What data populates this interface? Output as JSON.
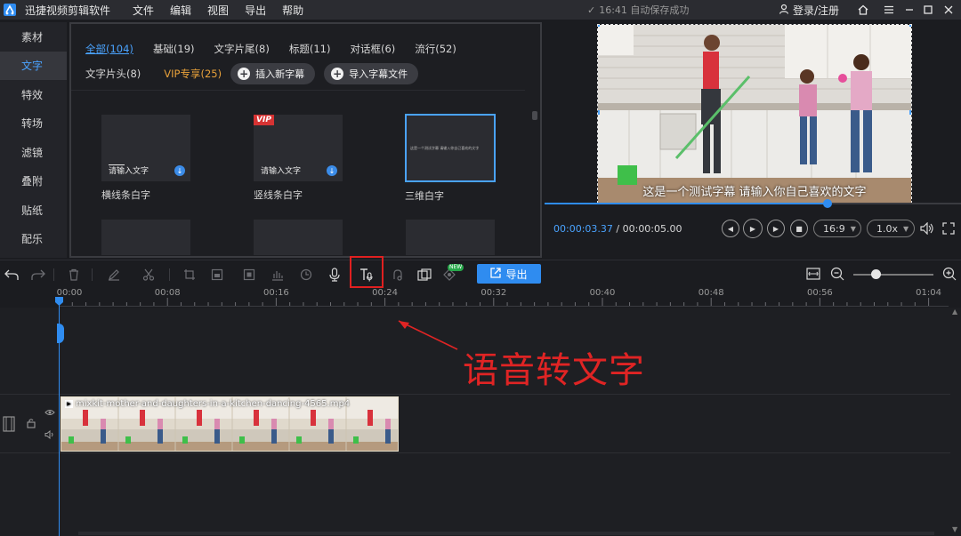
{
  "app": {
    "name": "迅捷视频剪辑软件",
    "menu": [
      "文件",
      "编辑",
      "视图",
      "导出",
      "帮助"
    ],
    "autosave": "16:41 自动保存成功",
    "login": "登录/注册",
    "icons": [
      "app-logo-icon",
      "home-icon",
      "settings-icon",
      "minimize-icon",
      "maximize-icon",
      "close-icon"
    ]
  },
  "left_nav": {
    "items": [
      "素材",
      "文字",
      "特效",
      "转场",
      "滤镜",
      "叠附",
      "贴纸",
      "配乐"
    ],
    "active": "文字"
  },
  "library": {
    "tabs": [
      "全部(104)",
      "基础(19)",
      "文字片尾(8)",
      "标题(11)",
      "对话框(6)",
      "流行(52)"
    ],
    "active_tab": "全部(104)",
    "tabs2": [
      "文字片头(8)",
      "VIP专享(25)"
    ],
    "insert_button": "插入新字幕",
    "import_button": "导入字幕文件",
    "templates": [
      {
        "name": "横线条白字",
        "thumb_text": "请输入文字",
        "vip": false
      },
      {
        "name": "竖线条白字",
        "thumb_text": "请输入文字",
        "vip": true,
        "badge": "VIP"
      },
      {
        "name": "三维白字",
        "thumb_text": "这是一个测试字幕 请输入你自己喜欢的文字",
        "vip": false,
        "selected": true
      }
    ]
  },
  "preview": {
    "caption": "这是一个测试字幕 请输入你自己喜欢的文字",
    "current_time": "00:00:03.37",
    "separator": " / ",
    "total_time": "00:00:05.00",
    "progress": 0.68,
    "aspect_ratio": "16:9",
    "speed": "1.0x"
  },
  "toolbar": {
    "export_label": "导出",
    "new_badge": "NEW",
    "highlighted_tool": "speech-to-text-button"
  },
  "timeline": {
    "ticks": [
      "00:00",
      "00:08",
      "00:16",
      "00:24",
      "00:32",
      "00:40",
      "00:48",
      "00:56",
      "01:04"
    ],
    "clip_name": "mixkit-mother-and-daughters-in-a-kitchen-dancing-4565.mp4"
  },
  "annotation": {
    "text": "语音转文字",
    "color": "#e02424"
  },
  "colors": {
    "accent": "#2f8cf0",
    "vip": "#e8a13a",
    "annotation": "#e02020"
  }
}
